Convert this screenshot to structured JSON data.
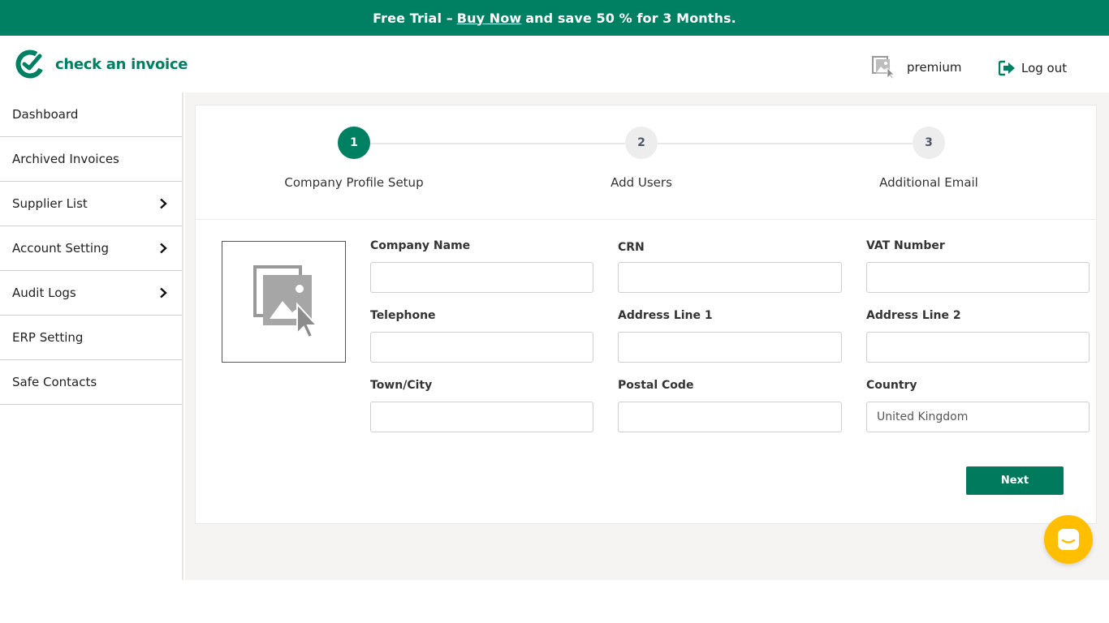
{
  "banner": {
    "prefix": "Free Trial –",
    "link": "Buy Now",
    "suffix": "and save 50 % for 3 Months."
  },
  "brand": {
    "name": "check an invoice",
    "color": "#008062"
  },
  "user": {
    "name": "premium",
    "avatar_icon": "image-placeholder-icon"
  },
  "logout": {
    "label": "Log out",
    "icon": "logout-icon"
  },
  "sidebar": {
    "items": [
      {
        "label": "Dashboard",
        "has_submenu": false
      },
      {
        "label": "Archived Invoices",
        "has_submenu": false
      },
      {
        "label": "Supplier List",
        "has_submenu": true
      },
      {
        "label": "Account Setting",
        "has_submenu": true
      },
      {
        "label": "Audit Logs",
        "has_submenu": true
      },
      {
        "label": "ERP Setting",
        "has_submenu": false
      },
      {
        "label": "Safe Contacts",
        "has_submenu": false
      }
    ]
  },
  "stepper": {
    "active_step": 1,
    "steps": [
      {
        "number": "1",
        "label": "Company Profile Setup"
      },
      {
        "number": "2",
        "label": "Add Users"
      },
      {
        "number": "3",
        "label": "Additional Email"
      }
    ]
  },
  "form": {
    "fields": [
      {
        "label": "Company Name",
        "value": ""
      },
      {
        "label": "CRN",
        "value": ""
      },
      {
        "label": "VAT Number",
        "value": ""
      },
      {
        "label": "Telephone",
        "value": ""
      },
      {
        "label": "Address Line 1",
        "value": ""
      },
      {
        "label": "Address Line 2",
        "value": ""
      },
      {
        "label": "Town/City",
        "value": ""
      },
      {
        "label": "Postal Code",
        "value": ""
      },
      {
        "label": "Country",
        "value": "United Kingdom"
      }
    ],
    "next_label": "Next"
  },
  "colors": {
    "primary": "#008062",
    "chat": "#ffbf00"
  }
}
